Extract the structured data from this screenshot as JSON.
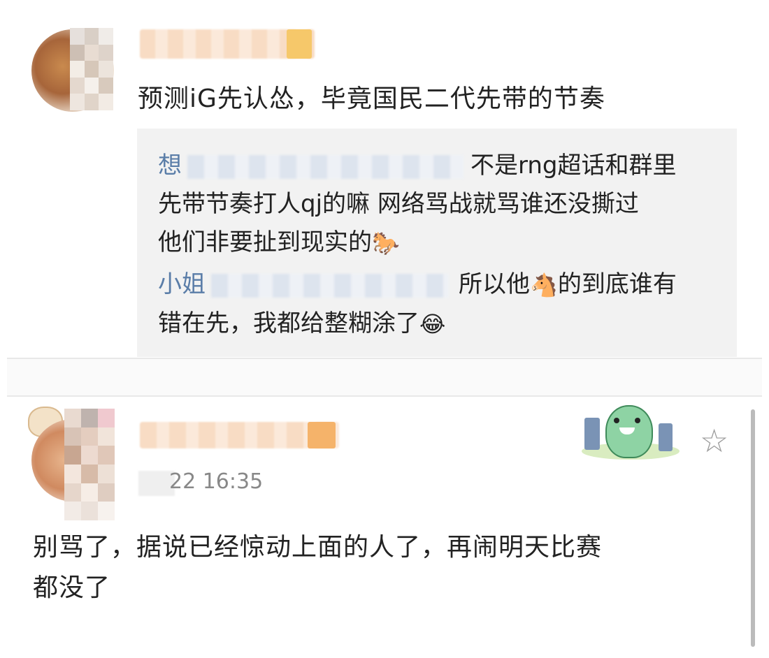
{
  "comment1": {
    "username": "",
    "text": "预测iG先认怂，毕竟国民二代先带的节奏",
    "replies": [
      {
        "name": "想",
        "lines": [
          "不是rng超话和群里",
          "先带节奏打人qj的嘛 网络骂战就骂谁还没撕过",
          "他们非要扯到现实的"
        ],
        "emoji": "🐎"
      },
      {
        "name": "小姐",
        "lines": [
          "所以他",
          "的到底谁有",
          "错在先，我都给整糊涂了"
        ],
        "emoji_mid": "🐴",
        "emoji_end": "😂"
      }
    ]
  },
  "comment2": {
    "username": "",
    "time": "22 16:35",
    "text_line1": "别骂了，据说已经惊动上面的人了，再闹明天比赛",
    "text_line2": "都没了"
  },
  "icons": {
    "star": "star-outline-icon",
    "sticker": "green-dinosaur-sticker",
    "avatar_decoration": "bear-avatar-badge"
  },
  "colors": {
    "reply_name": "#5a7da8",
    "reply_bg": "#f2f2f2",
    "divider": "#e8e8e8"
  }
}
